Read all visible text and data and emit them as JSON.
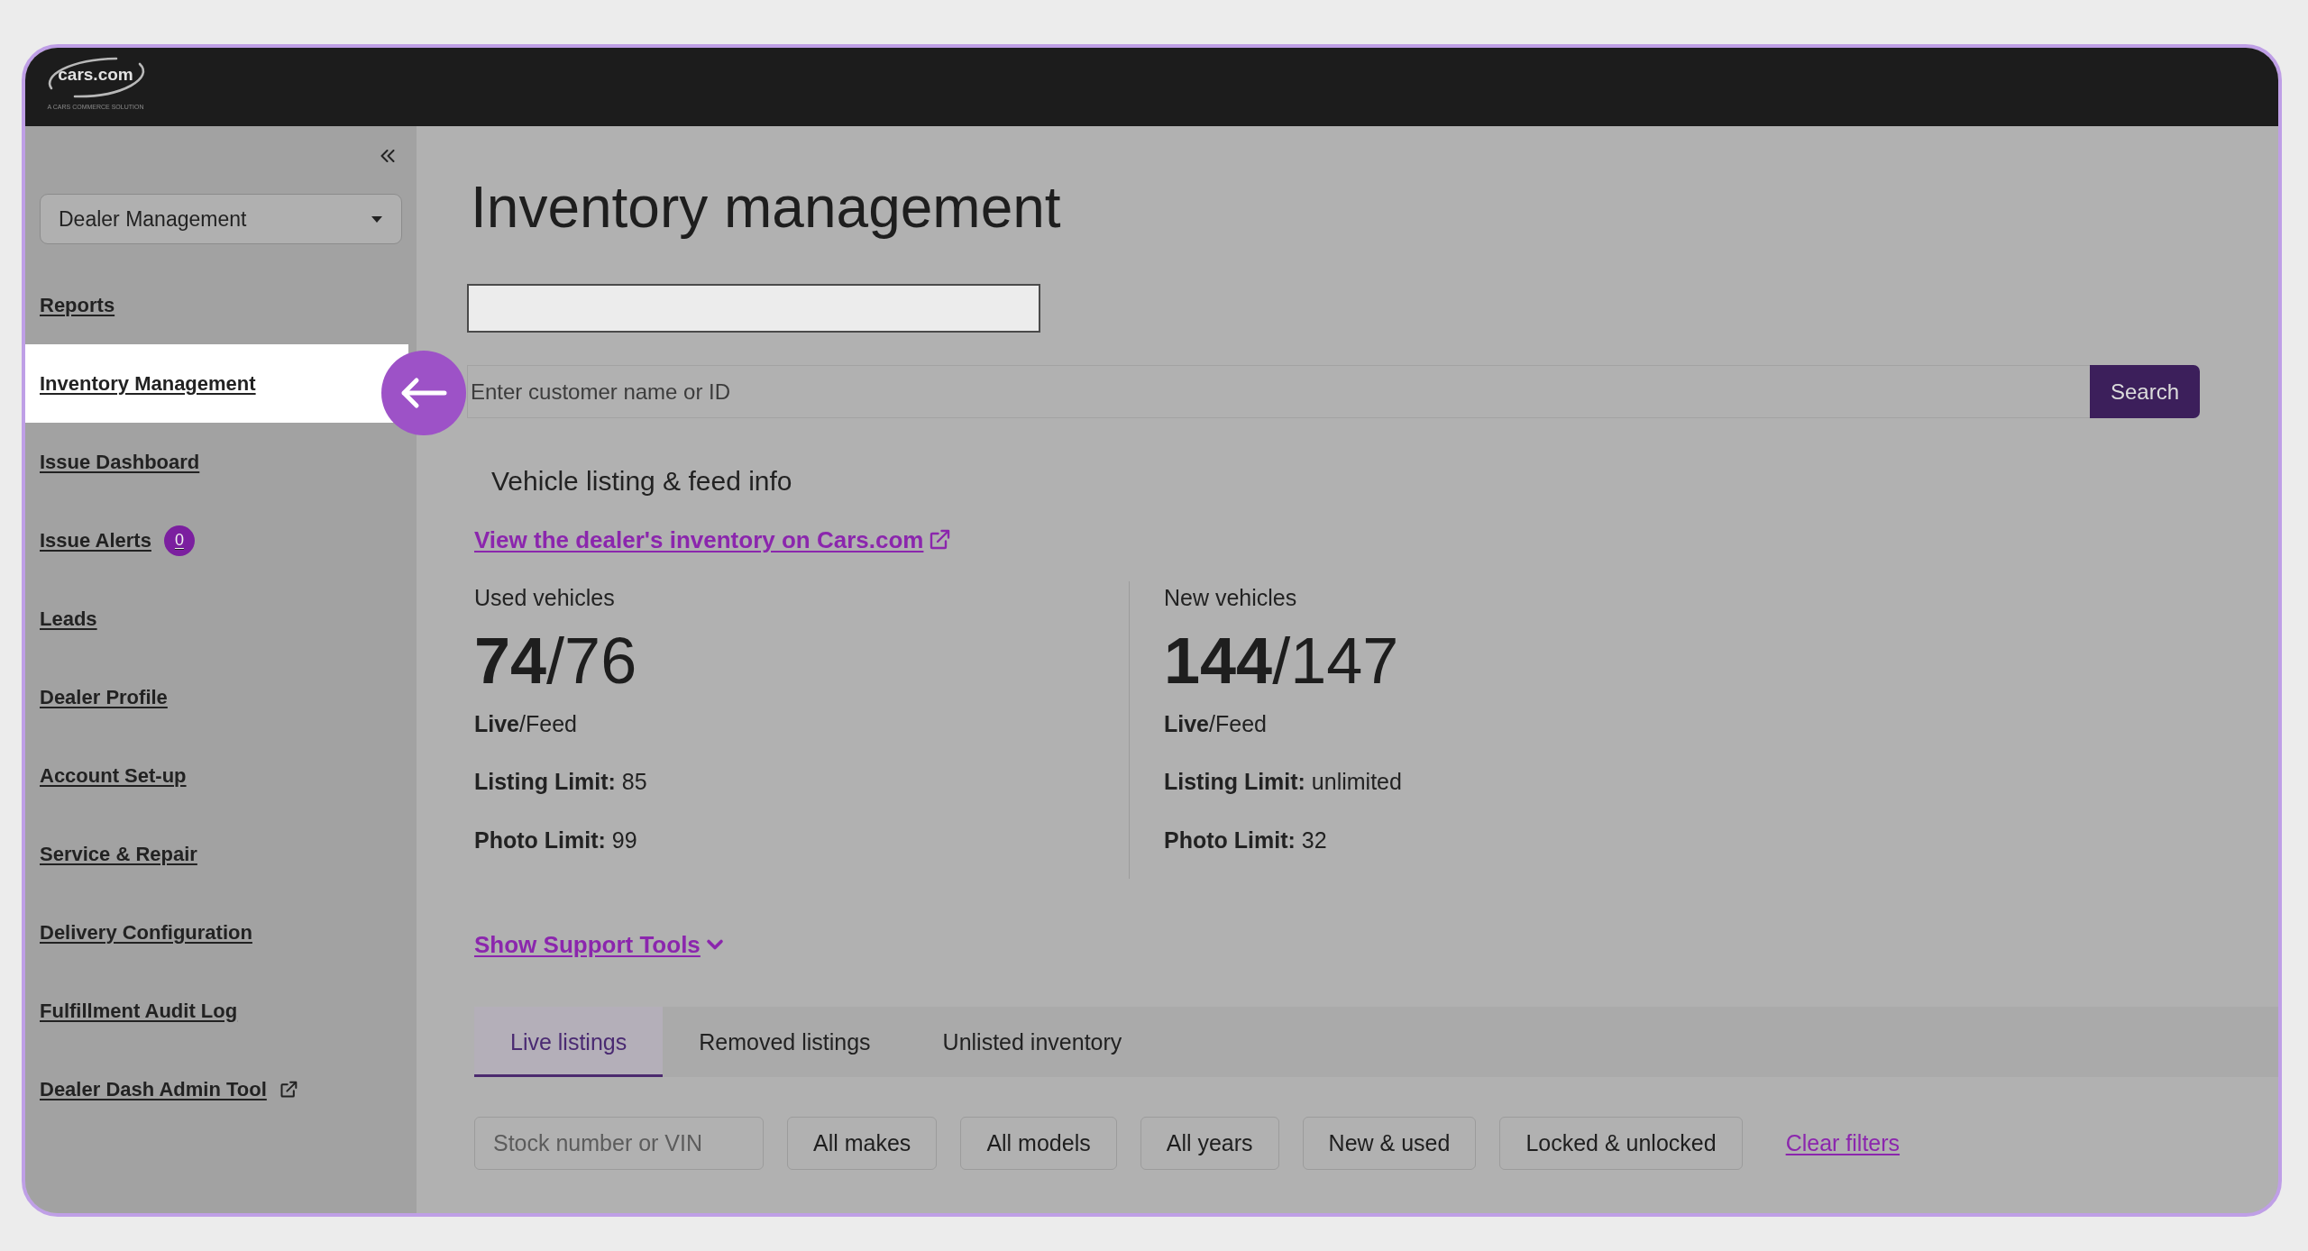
{
  "header": {
    "logo": {
      "wordmark": "cars.com",
      "tagline": "A CARS COMMERCE SOLUTION"
    }
  },
  "sidebar": {
    "section_select": {
      "value": "Dealer Management"
    },
    "items": [
      {
        "label": "Reports",
        "selected": false,
        "external": false
      },
      {
        "label": "Inventory Management",
        "selected": true,
        "external": false
      },
      {
        "label": "Issue Dashboard",
        "selected": false,
        "external": false
      },
      {
        "label": "Issue Alerts",
        "selected": false,
        "external": false,
        "badge": "0"
      },
      {
        "label": "Leads",
        "selected": false,
        "external": false
      },
      {
        "label": "Dealer Profile",
        "selected": false,
        "external": false
      },
      {
        "label": "Account Set-up",
        "selected": false,
        "external": false
      },
      {
        "label": "Service & Repair",
        "selected": false,
        "external": false
      },
      {
        "label": "Delivery Configuration",
        "selected": false,
        "external": false
      },
      {
        "label": "Fulfillment Audit Log",
        "selected": false,
        "external": false
      },
      {
        "label": "Dealer Dash Admin Tool",
        "selected": false,
        "external": true
      }
    ]
  },
  "main": {
    "title": "Inventory management",
    "customer_search": {
      "placeholder": "Enter customer name or ID",
      "button": "Search"
    },
    "vehicle_info": {
      "heading": "Vehicle listing & feed info",
      "inventory_link": "View the dealer's inventory on Cars.com",
      "groups": [
        {
          "title": "Used vehicles",
          "count": "**74**/76",
          "count_caption": "**Live**/Feed",
          "listing_limit": "**Listing Limit:** 85",
          "photo_limit": "**Photo Limit:** 99"
        },
        {
          "title": "New vehicles",
          "count": "**144**/147",
          "count_caption": "**Live**/Feed",
          "listing_limit": "**Listing Limit:** unlimited",
          "photo_limit": "**Photo Limit:** 32"
        }
      ]
    },
    "support_tools_link": "Show Support Tools",
    "tabs": [
      {
        "label": "Live listings",
        "selected": true
      },
      {
        "label": "Removed listings",
        "selected": false
      },
      {
        "label": "Unlisted inventory",
        "selected": false
      }
    ],
    "filters": {
      "search": {
        "placeholder": "Stock number or VIN"
      },
      "dropdowns": [
        "All makes",
        "All models",
        "All years",
        "New & used",
        "Locked & unlocked"
      ],
      "clear_link": "Clear filters"
    }
  }
}
